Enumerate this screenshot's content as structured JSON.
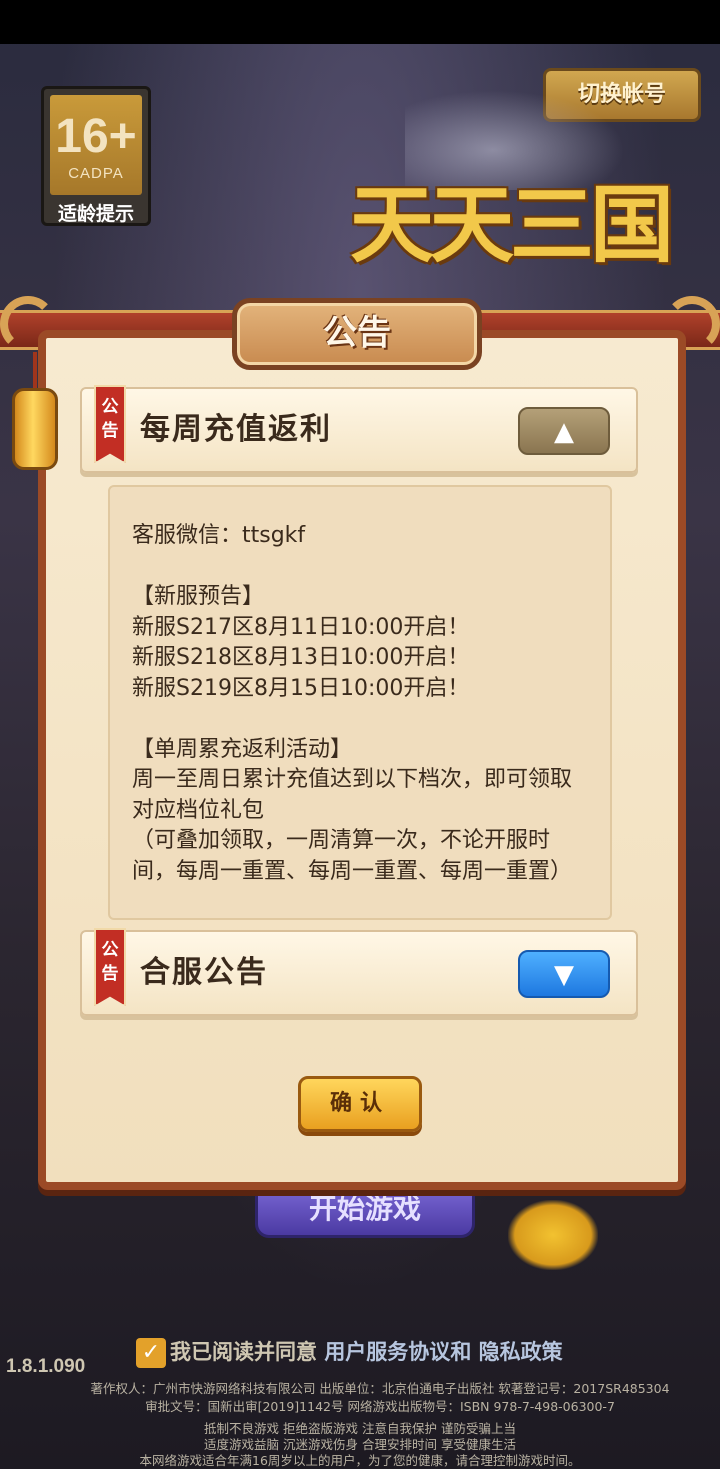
{
  "age_rating": {
    "rating": "16+",
    "org": "CADPA",
    "tip": "适龄提示"
  },
  "header": {
    "switch_account": "切换帐号",
    "logo_text": "天天三国"
  },
  "background": {
    "start_game": "开始游戏"
  },
  "dialog": {
    "title": "公告",
    "tag": "公告",
    "announcements": [
      {
        "title": "每周充值返利",
        "expanded": true,
        "toggle": "▲",
        "body": {
          "wechat": "客服微信：ttsgkf",
          "new_server_heading": "【新服预告】",
          "servers": [
            "新服S217区8月11日10:00开启！",
            "新服S218区8月13日10:00开启！",
            "新服S219区8月15日10:00开启！"
          ],
          "activity_heading": "【单周累充返利活动】",
          "activity_desc": "周一至周日累计充值达到以下档次，即可领取对应档位礼包",
          "activity_note": "（可叠加领取，一周清算一次，不论开服时间，每周一重置、每周一重置、每周一重置）"
        }
      },
      {
        "title": "合服公告",
        "expanded": false,
        "toggle": "▼"
      }
    ],
    "confirm": "确认"
  },
  "footer": {
    "checkbox_mark": "✓",
    "agree_prefix": "我已阅读并同意",
    "user_agreement": "用户服务协议",
    "and": "和",
    "privacy_policy": "隐私政策",
    "version": "1.8.1.090",
    "legal_lines": [
      "著作权人：广州市快游网络科技有限公司 出版单位：北京伯通电子出版社 软著登记号：2017SR485304",
      "审批文号：国新出审[2019]1142号 网络游戏出版物号：ISBN 978-7-498-06300-7",
      "抵制不良游戏 拒绝盗版游戏 注意自我保护 谨防受骗上当",
      "适度游戏益脑 沉迷游戏伤身 合理安排时间 享受健康生活",
      "本网络游戏适合年满16周岁以上的用户，为了您的健康，请合理控制游戏时间。"
    ]
  },
  "colors": {
    "dialog_border": "#9b4a26",
    "parchment": "#f7ead0",
    "tag_red": "#c22e24",
    "toggle_blue": "#1e78e0",
    "confirm_gold": "#e9a020"
  }
}
